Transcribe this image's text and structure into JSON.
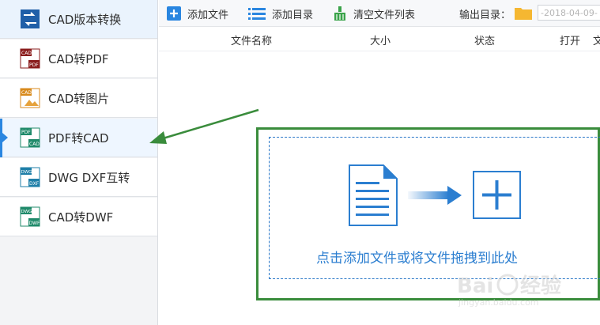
{
  "sidebar": {
    "items": [
      {
        "label": "CAD版本转换",
        "icon": "cad-version-convert-icon",
        "active": false
      },
      {
        "label": "CAD转PDF",
        "icon": "cad-to-pdf-icon",
        "active": false
      },
      {
        "label": "CAD转图片",
        "icon": "cad-to-image-icon",
        "active": false
      },
      {
        "label": "PDF转CAD",
        "icon": "pdf-to-cad-icon",
        "active": true
      },
      {
        "label": "DWG DXF互转",
        "icon": "dwg-dxf-convert-icon",
        "active": false
      },
      {
        "label": "CAD转DWF",
        "icon": "cad-to-dwf-icon",
        "active": false
      }
    ]
  },
  "toolbar": {
    "add_file": "添加文件",
    "add_folder": "添加目录",
    "clear_list": "清空文件列表",
    "output_dir_label": "输出目录：",
    "output_dir_value": "-2018-04-09-"
  },
  "columns": {
    "name": "文件名称",
    "size": "大小",
    "status": "状态",
    "open": "打开",
    "folder": "文"
  },
  "drop_zone": {
    "text": "点击添加文件或将文件拖拽到此处"
  },
  "watermark": {
    "text": "Baidu经验",
    "sub": "jingyan.baidu.com"
  },
  "colors": {
    "accent": "#2a86e0",
    "highlight_green": "#3a8c3c",
    "drop_text": "#2b7ed0"
  }
}
